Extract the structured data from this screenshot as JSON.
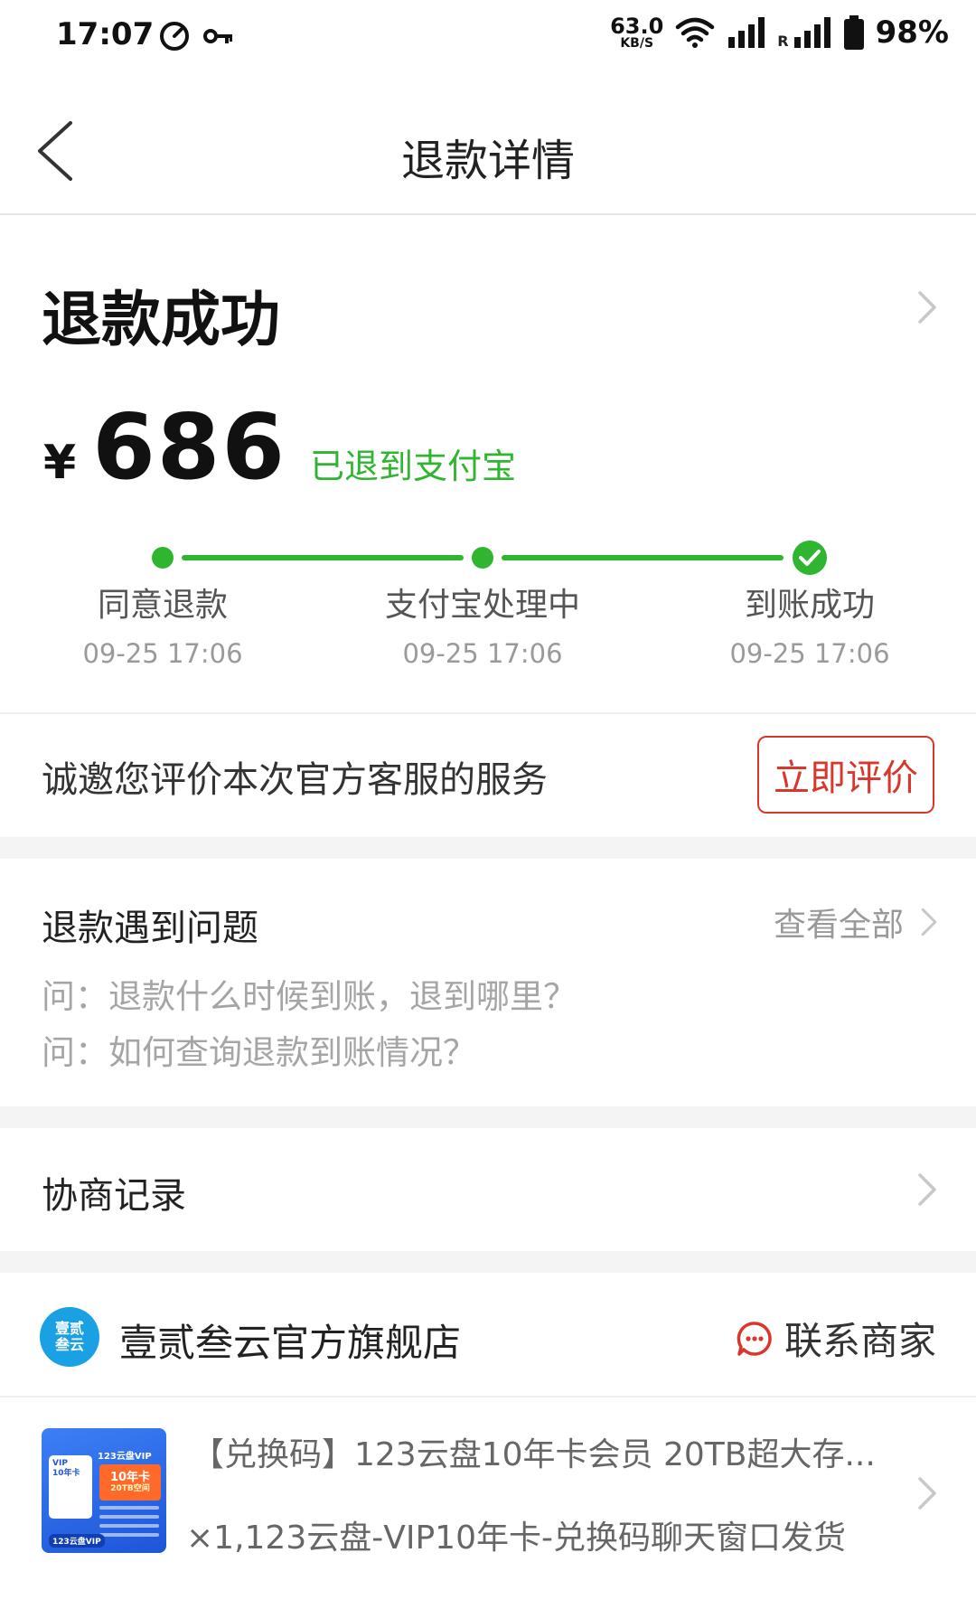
{
  "status_bar": {
    "time": "17:07",
    "net_speed": "63.0",
    "net_speed_unit": "KB/S",
    "roaming": "R",
    "battery": "98%"
  },
  "nav": {
    "title": "退款详情"
  },
  "refund": {
    "status": "退款成功",
    "currency": "¥",
    "amount": "686",
    "destination": "已退到支付宝",
    "steps": [
      {
        "label": "同意退款",
        "time": "09-25 17:06"
      },
      {
        "label": "支付宝处理中",
        "time": "09-25 17:06"
      },
      {
        "label": "到账成功",
        "time": "09-25 17:06"
      }
    ]
  },
  "rating": {
    "prompt": "诚邀您评价本次官方客服的服务",
    "button": "立即评价"
  },
  "faq": {
    "title": "退款遇到问题",
    "view_all": "查看全部",
    "questions": [
      "问：退款什么时候到账，退到哪里？",
      "问：如何查询退款到账情况？"
    ]
  },
  "negotiation": {
    "title": "协商记录"
  },
  "store": {
    "logo_text": "壹贰\n叁云",
    "name": "壹贰叁云官方旗舰店",
    "contact": "联系商家"
  },
  "product": {
    "title": "【兑换码】123云盘10年卡会员 20TB超大存...",
    "sku": "×1,123云盘-VIP10年卡-兑换码聊天窗口发货",
    "thumb": {
      "brand": "123云盘VIP",
      "card_line1": "VIP",
      "card_line2": "10年卡",
      "badge_main": "10年卡",
      "badge_sub": "20TB空间",
      "footer": "123云盘VIP"
    }
  },
  "colors": {
    "accent_green": "#2fb52f",
    "accent_red": "#d9372b",
    "store_blue": "#1aa1e3"
  }
}
